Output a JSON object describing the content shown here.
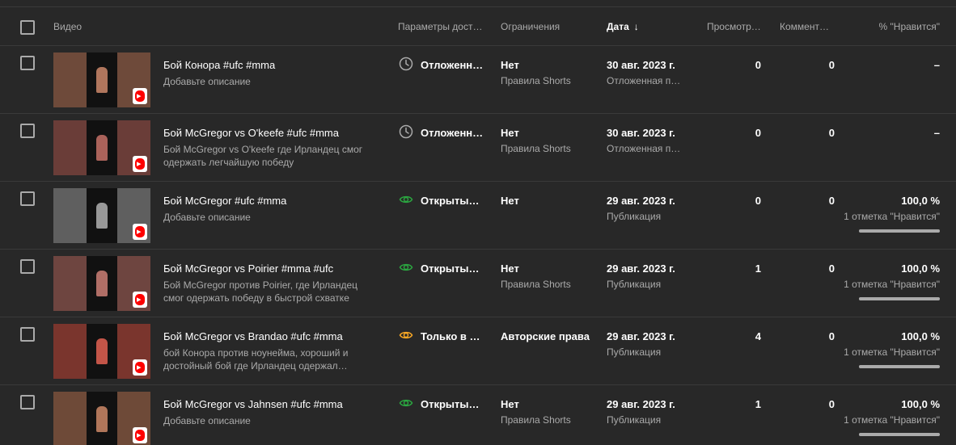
{
  "header": {
    "video": "Видео",
    "visibility": "Параметры дост…",
    "restrictions": "Ограничения",
    "date": "Дата",
    "sort_arrow": "↓",
    "views": "Просмотр…",
    "comments": "Коммент…",
    "likes": "% \"Нравится\""
  },
  "colors": {
    "scheduled_icon": "#aaaaaa",
    "public_icon": "#2ba640",
    "unlisted_icon": "#f9a825",
    "shorts_badge": "#ff0000"
  },
  "rows": [
    {
      "title": "Бой Конора #ufc #mma",
      "description": "Добавьте описание",
      "visibility_icon": "clock-icon",
      "visibility": "Отложенна…",
      "restriction": "Нет",
      "restriction_sub": "Правила Shorts",
      "date": "30 авг. 2023 г.",
      "date_sub": "Отложенная пу…",
      "views": "0",
      "comments": "0",
      "likes_pct": "–",
      "likes_count": "",
      "likes_fraction": null,
      "thumb_color": "#6e4a3a"
    },
    {
      "title": "Бой McGregor vs O'keefe #ufc #mma",
      "description": "Бой McGregor vs O'keefe где Ирландец смог одержать легчайшую победу",
      "visibility_icon": "clock-icon",
      "visibility": "Отложенна…",
      "restriction": "Нет",
      "restriction_sub": "Правила Shorts",
      "date": "30 авг. 2023 г.",
      "date_sub": "Отложенная пу…",
      "views": "0",
      "comments": "0",
      "likes_pct": "–",
      "likes_count": "",
      "likes_fraction": null,
      "thumb_color": "#6a3d38"
    },
    {
      "title": "Бой McGregor #ufc #mma",
      "description": "Добавьте описание",
      "visibility_icon": "eye-icon",
      "visibility": "Открытый …",
      "restriction": "Нет",
      "restriction_sub": "",
      "date": "29 авг. 2023 г.",
      "date_sub": "Публикация",
      "views": "0",
      "comments": "0",
      "likes_pct": "100,0 %",
      "likes_count": "1 отметка \"Нравится\"",
      "likes_fraction": 1.0,
      "thumb_color": "#5f5f5f"
    },
    {
      "title": "Бой McGregor vs Poirier #mma #ufc",
      "description": "Бой McGregor против Poirier, где Ирландец смог одержать победу в быстрой схватке",
      "visibility_icon": "eye-icon",
      "visibility": "Открытый …",
      "restriction": "Нет",
      "restriction_sub": "Правила Shorts",
      "date": "29 авг. 2023 г.",
      "date_sub": "Публикация",
      "views": "1",
      "comments": "0",
      "likes_pct": "100,0 %",
      "likes_count": "1 отметка \"Нравится\"",
      "likes_fraction": 1.0,
      "thumb_color": "#6e4540"
    },
    {
      "title": "Бой McGregor vs Brandao #ufc #mma",
      "description": "бой Конора против ноунейма, хороший и достойный бой где Ирландец одержал…",
      "visibility_icon": "eye-icon",
      "visibility": "Только в н…",
      "restriction": "Авторские права",
      "restriction_sub": "",
      "date": "29 авг. 2023 г.",
      "date_sub": "Публикация",
      "views": "4",
      "comments": "0",
      "likes_pct": "100,0 %",
      "likes_count": "1 отметка \"Нравится\"",
      "likes_fraction": 1.0,
      "thumb_color": "#7a352d"
    },
    {
      "title": "Бой McGregor vs Jahnsen #ufc #mma",
      "description": "Добавьте описание",
      "visibility_icon": "eye-icon",
      "visibility": "Открытый …",
      "restriction": "Нет",
      "restriction_sub": "Правила Shorts",
      "date": "29 авг. 2023 г.",
      "date_sub": "Публикация",
      "views": "1",
      "comments": "0",
      "likes_pct": "100,0 %",
      "likes_count": "1 отметка \"Нравится\"",
      "likes_fraction": 1.0,
      "thumb_color": "#6e4a38"
    }
  ]
}
